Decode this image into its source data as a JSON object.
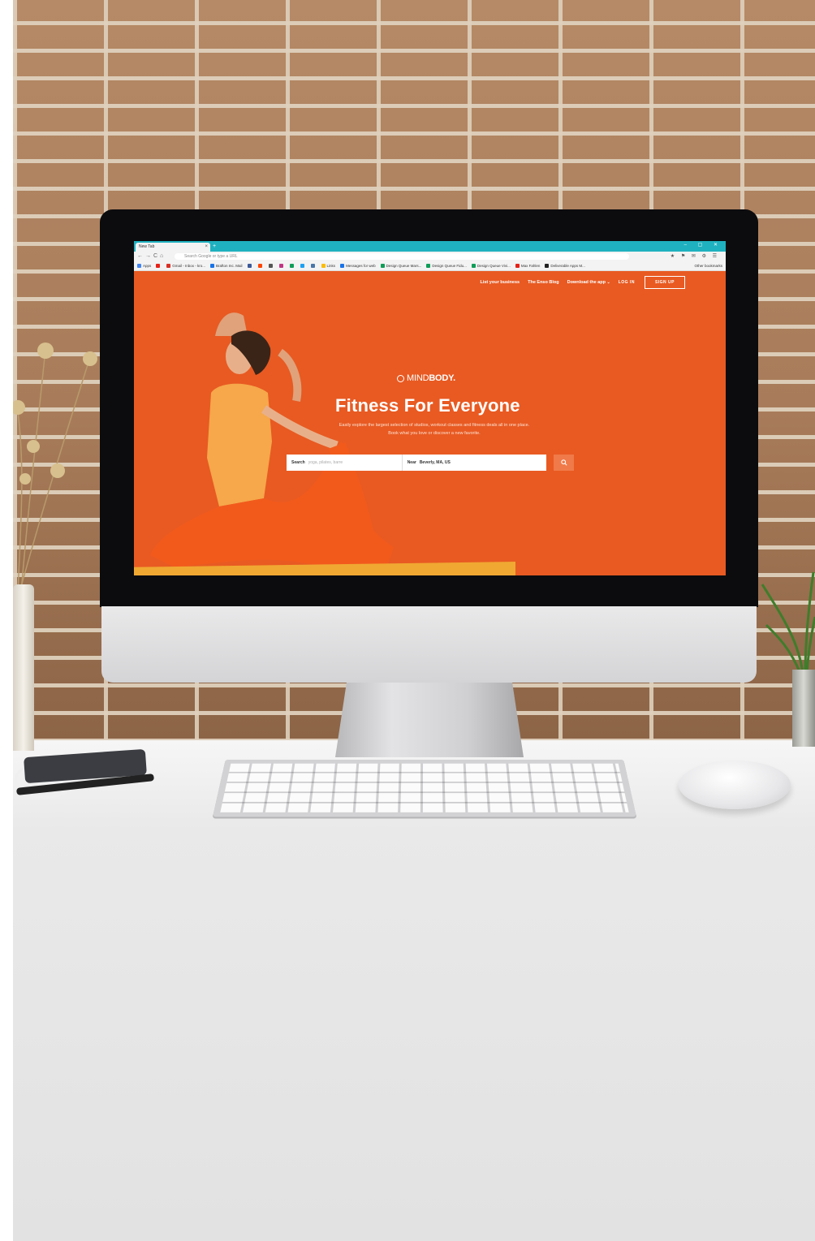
{
  "browser": {
    "tab_title": "New Tab",
    "tab_close": "×",
    "new_tab": "+",
    "window_controls": "–  ▢  ✕",
    "nav_buttons": "←→C⌂",
    "omnibox_placeholder": "Search Google or type a URL",
    "extensions": "★ ⚑ ✉ ⚙ ☰",
    "bookmarks": [
      {
        "label": "Apps",
        "color": "#4285f4"
      },
      {
        "label": "",
        "color": "#e62117"
      },
      {
        "label": "Gmail - Inbox - kro...",
        "color": "#d93025"
      },
      {
        "label": "Brafton Inc. Mail",
        "color": "#1a73e8"
      },
      {
        "label": "",
        "color": "#3b5998"
      },
      {
        "label": "",
        "color": "#ff4500"
      },
      {
        "label": "",
        "color": "#555555"
      },
      {
        "label": "",
        "color": "#c13584"
      },
      {
        "label": "",
        "color": "#0f9d58"
      },
      {
        "label": "",
        "color": "#1da1f2"
      },
      {
        "label": "",
        "color": "#4a76a8"
      },
      {
        "label": "Links",
        "color": "#fbbc05"
      },
      {
        "label": "Messages for web",
        "color": "#1a73e8"
      },
      {
        "label": "Design Queue Mars...",
        "color": "#0f9d58"
      },
      {
        "label": "Design Queue Fidu...",
        "color": "#0f9d58"
      },
      {
        "label": "Design Queue Vivi...",
        "color": "#0f9d58"
      },
      {
        "label": "Max Fahlen",
        "color": "#e62117"
      },
      {
        "label": "Deliverable Apps M...",
        "color": "#222222"
      }
    ],
    "other_bookmarks": "Other bookmarks"
  },
  "site": {
    "nav": {
      "list_business": "List your business",
      "blog": "The Enso Blog",
      "download_app": "Download the app",
      "download_caret": "⌄",
      "login": "LOG IN",
      "signup": "SIGN UP"
    },
    "logo_prefix": "MIND",
    "logo_suffix": "BODY.",
    "hero_title": "Fitness For Everyone",
    "hero_sub_line1": "Easily explore the largest selection of studios, workout classes and fitness deals all in one place.",
    "hero_sub_line2": "Book what you love or discover a new favorite.",
    "search": {
      "search_label": "Search",
      "search_placeholder": "yoga, pilates, barre",
      "near_label": "Near",
      "near_value": "Beverly, MA, US",
      "button_icon": "search-icon"
    }
  },
  "colors": {
    "brand_orange": "#e85a22",
    "tab_bar_teal": "#1fb1c0",
    "search_button": "#f07a4a"
  }
}
